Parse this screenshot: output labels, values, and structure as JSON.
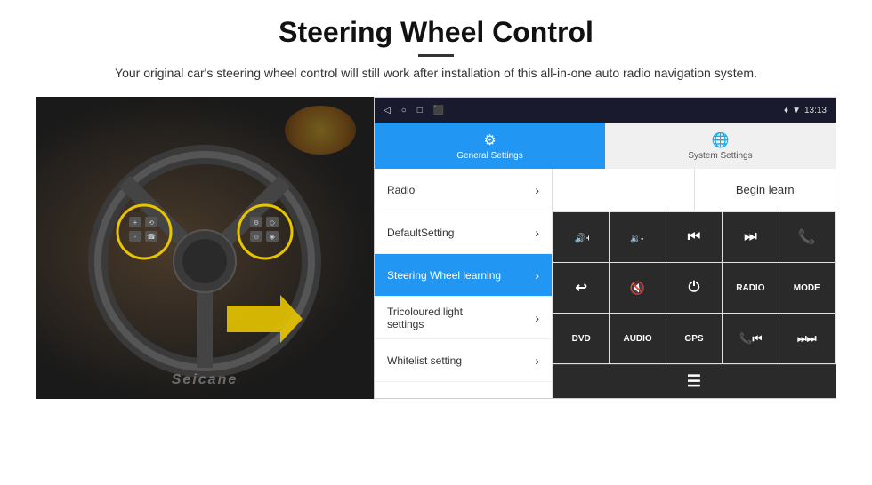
{
  "header": {
    "title": "Steering Wheel Control",
    "subtitle": "Your original car's steering wheel control will still work after installation of this all-in-one auto radio navigation system."
  },
  "status_bar": {
    "time": "13:13",
    "nav_icons": [
      "◁",
      "○",
      "□",
      "⬛"
    ],
    "signal_icon": "♦",
    "wifi_icon": "▼"
  },
  "tabs": [
    {
      "label": "General Settings",
      "icon": "⚙",
      "active": true
    },
    {
      "label": "System Settings",
      "icon": "🌐",
      "active": false
    }
  ],
  "menu_items": [
    {
      "label": "Radio",
      "active": false
    },
    {
      "label": "DefaultSetting",
      "active": false
    },
    {
      "label": "Steering Wheel learning",
      "active": true
    },
    {
      "label": "Tricoloured light settings",
      "active": false
    },
    {
      "label": "Whitelist setting",
      "active": false
    }
  ],
  "begin_learn_label": "Begin learn",
  "control_buttons": [
    {
      "icon": "vol_up",
      "label": "🔊+"
    },
    {
      "icon": "vol_down",
      "label": "🔉-"
    },
    {
      "icon": "prev",
      "label": "⏮"
    },
    {
      "icon": "next",
      "label": "⏭"
    },
    {
      "icon": "phone",
      "label": "📞"
    },
    {
      "icon": "back",
      "label": "↩"
    },
    {
      "icon": "mute",
      "label": "🔇"
    },
    {
      "icon": "power",
      "label": "⏻"
    },
    {
      "icon": "radio_btn",
      "label": "RADIO"
    },
    {
      "icon": "mode",
      "label": "MODE"
    },
    {
      "icon": "dvd",
      "label": "DVD"
    },
    {
      "icon": "audio",
      "label": "AUDIO"
    },
    {
      "icon": "gps",
      "label": "GPS"
    },
    {
      "icon": "phone_prev",
      "label": "📞⏮"
    },
    {
      "icon": "skip_back",
      "label": "⏭⏭"
    }
  ],
  "bottom_row_icon": "≡",
  "watermark": "Seicane"
}
